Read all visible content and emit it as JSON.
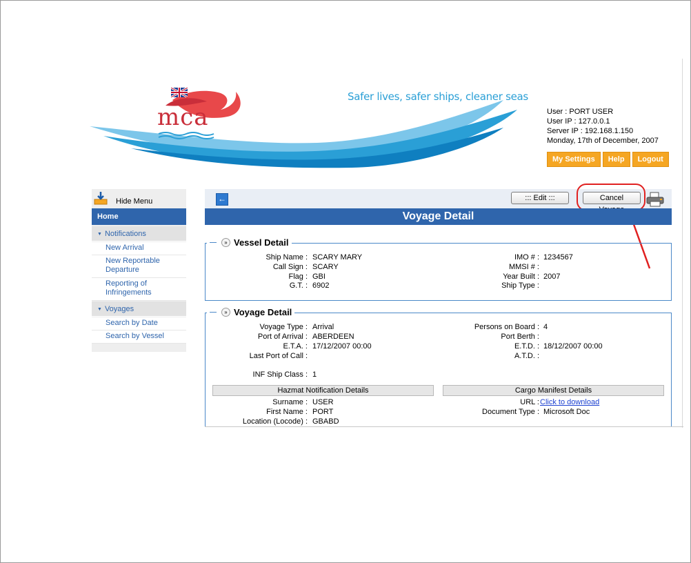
{
  "header": {
    "tagline": "Safer lives,  safer ships, cleaner seas",
    "logo_text": "mca",
    "user_info": [
      "User : PORT USER",
      "User IP : 127.0.0.1",
      "Server IP : 192.168.1.150",
      "Monday, 17th of December, 2007"
    ],
    "buttons": {
      "settings": "My Settings",
      "help": "Help",
      "logout": "Logout"
    }
  },
  "sidebar": {
    "hide_menu": "Hide Menu",
    "home": "Home",
    "notifications": {
      "label": "Notifications",
      "items": [
        "New Arrival",
        "New Reportable Departure",
        "Reporting of Infringements"
      ]
    },
    "voyages": {
      "label": "Voyages",
      "items": [
        "Search by Date",
        "Search by Vessel"
      ]
    }
  },
  "toolbar": {
    "back": "←",
    "edit": "::: Edit :::",
    "cancel_voyage": "Cancel Voyage"
  },
  "page_title": "Voyage Detail",
  "vessel_detail": {
    "legend": "Vessel Detail",
    "left": [
      {
        "label": "Ship Name :",
        "value": "SCARY MARY"
      },
      {
        "label": "Call Sign :",
        "value": "SCARY"
      },
      {
        "label": "Flag :",
        "value": "GBI"
      },
      {
        "label": "G.T. :",
        "value": "6902"
      }
    ],
    "right": [
      {
        "label": "IMO # :",
        "value": "1234567"
      },
      {
        "label": "MMSI # :",
        "value": ""
      },
      {
        "label": "Year Built :",
        "value": "2007"
      },
      {
        "label": "Ship Type :",
        "value": ""
      }
    ]
  },
  "voyage_detail": {
    "legend": "Voyage Detail",
    "left": [
      {
        "label": "Voyage Type :",
        "value": "Arrival"
      },
      {
        "label": "Port of Arrival :",
        "value": "ABERDEEN"
      },
      {
        "label": "E.T.A. :",
        "value": "17/12/2007 00:00"
      },
      {
        "label": "Last Port of Call :",
        "value": ""
      }
    ],
    "right": [
      {
        "label": "Persons on Board :",
        "value": "4"
      },
      {
        "label": "Port Berth :",
        "value": ""
      },
      {
        "label": "E.T.D. :",
        "value": "18/12/2007 00:00"
      },
      {
        "label": "A.T.D. :",
        "value": ""
      }
    ],
    "inf_class": {
      "label": "INF Ship Class :",
      "value": "1"
    },
    "hazmat": {
      "heading": "Hazmat Notification Details",
      "rows": [
        {
          "label": "Surname :",
          "value": "USER"
        },
        {
          "label": "First Name :",
          "value": "PORT"
        },
        {
          "label": "Location (Locode) :",
          "value": "GBABD"
        }
      ]
    },
    "cargo": {
      "heading": "Cargo Manifest Details",
      "url_label": "URL :",
      "url_link": "Click to download",
      "doctype_label": "Document Type :",
      "doctype_value": "Microsoft Doc"
    }
  },
  "colors": {
    "nav_blue": "#2f65ac",
    "header_orange": "#f5a623",
    "annotation_red": "#e02020",
    "wave_blue": "#2a9fd6"
  }
}
